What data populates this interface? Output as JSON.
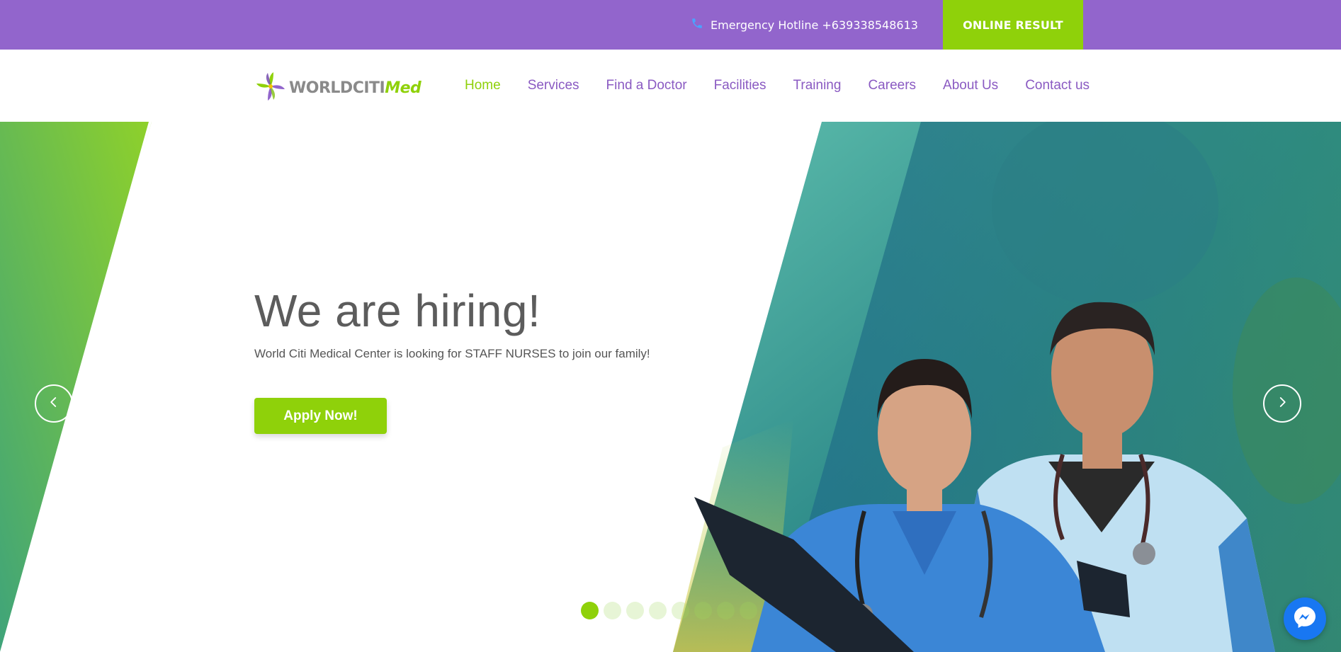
{
  "topbar": {
    "hotline_text": "Emergency Hotline +639338548613",
    "online_result_label": "ONLINE RESULT",
    "bg_color": "#9265cc",
    "accent_color": "#8fd10a"
  },
  "brand": {
    "name_part1": "WORLDCITI",
    "name_part2": "Med"
  },
  "nav": {
    "items": [
      {
        "label": "Home",
        "active": true
      },
      {
        "label": "Services"
      },
      {
        "label": "Find a Doctor"
      },
      {
        "label": "Facilities"
      },
      {
        "label": "Training"
      },
      {
        "label": "Careers"
      },
      {
        "label": "About Us"
      },
      {
        "label": "Contact us"
      }
    ]
  },
  "hero": {
    "headline": "We are hiring!",
    "subline": "World Citi Medical Center is looking for STAFF NURSES to join our family!",
    "cta_label": "Apply Now!",
    "slides_count": 8,
    "active_slide": 1
  },
  "icons": {
    "phone": "phone-icon",
    "prev": "chevron-left-icon",
    "next": "chevron-right-icon",
    "messenger": "messenger-icon"
  }
}
